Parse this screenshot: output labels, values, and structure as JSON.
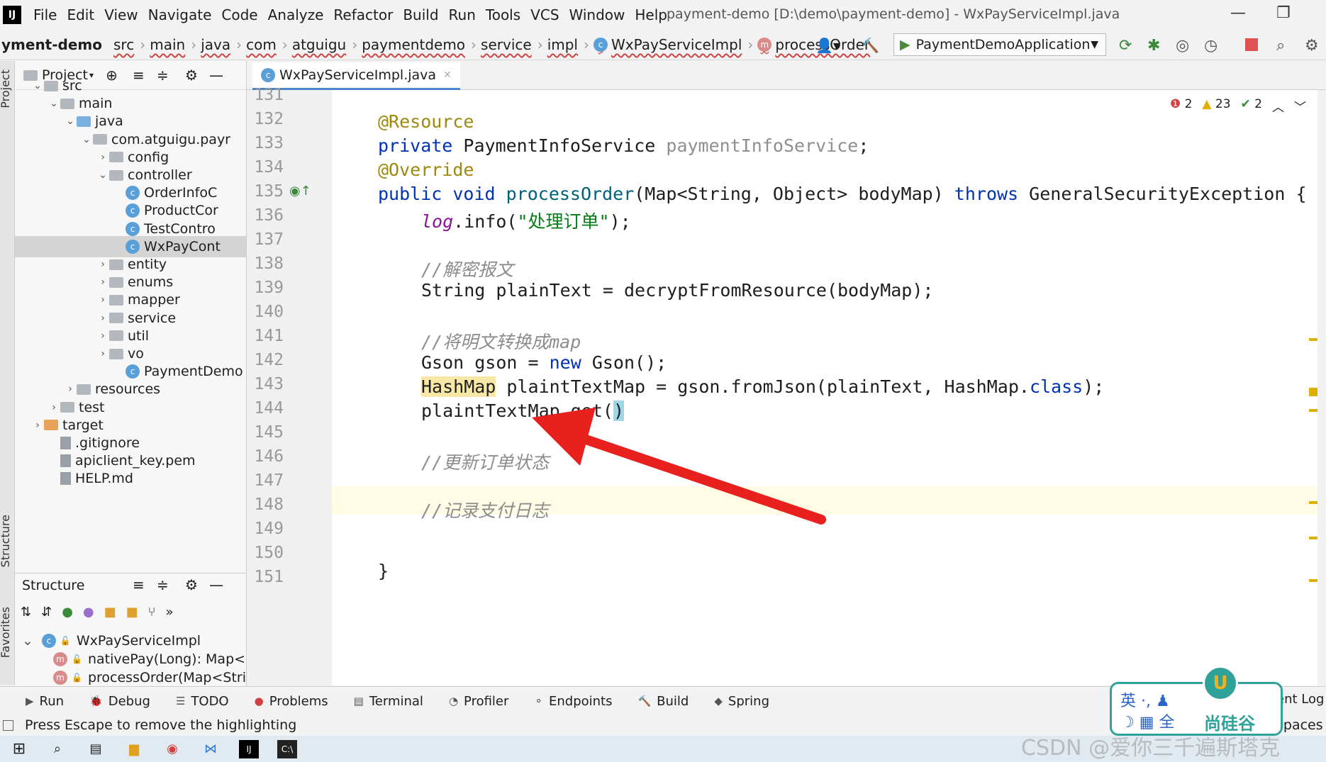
{
  "menu": {
    "logo": "IJ",
    "items": [
      "File",
      "Edit",
      "View",
      "Navigate",
      "Code",
      "Analyze",
      "Refactor",
      "Build",
      "Run",
      "Tools",
      "VCS",
      "Window",
      "Help"
    ],
    "window_title": "payment-demo [D:\\demo\\payment-demo] - WxPayServiceImpl.java"
  },
  "nav": {
    "project": "yment-demo",
    "crumbs": [
      "src",
      "main",
      "java",
      "com",
      "atguigu",
      "paymentdemo",
      "service",
      "impl",
      "WxPayServiceImpl",
      "processOrder"
    ],
    "run_config": "PaymentDemoApplication"
  },
  "left_strip": {
    "project": "Project",
    "structure": "Structure",
    "favorites": "Favorites"
  },
  "project": {
    "title": "Project",
    "tree": [
      {
        "label": "src",
        "indent": 1,
        "arrow": "v",
        "type": "folder"
      },
      {
        "label": "main",
        "indent": 2,
        "arrow": "v",
        "type": "folder"
      },
      {
        "label": "java",
        "indent": 3,
        "arrow": "v",
        "type": "folder-blue"
      },
      {
        "label": "com.atguigu.payr",
        "indent": 4,
        "arrow": "v",
        "type": "folder"
      },
      {
        "label": "config",
        "indent": 5,
        "arrow": ">",
        "type": "folder"
      },
      {
        "label": "controller",
        "indent": 5,
        "arrow": "v",
        "type": "folder"
      },
      {
        "label": "OrderInfoC",
        "indent": 6,
        "arrow": "",
        "type": "class"
      },
      {
        "label": "ProductCor",
        "indent": 6,
        "arrow": "",
        "type": "class"
      },
      {
        "label": "TestContro",
        "indent": 6,
        "arrow": "",
        "type": "class"
      },
      {
        "label": "WxPayCont",
        "indent": 6,
        "arrow": "",
        "type": "class",
        "selected": true
      },
      {
        "label": "entity",
        "indent": 5,
        "arrow": ">",
        "type": "folder"
      },
      {
        "label": "enums",
        "indent": 5,
        "arrow": ">",
        "type": "folder"
      },
      {
        "label": "mapper",
        "indent": 5,
        "arrow": ">",
        "type": "folder"
      },
      {
        "label": "service",
        "indent": 5,
        "arrow": ">",
        "type": "folder"
      },
      {
        "label": "util",
        "indent": 5,
        "arrow": ">",
        "type": "folder"
      },
      {
        "label": "vo",
        "indent": 5,
        "arrow": ">",
        "type": "folder"
      },
      {
        "label": "PaymentDemo",
        "indent": 6,
        "arrow": "",
        "type": "class"
      },
      {
        "label": "resources",
        "indent": 3,
        "arrow": ">",
        "type": "folder"
      },
      {
        "label": "test",
        "indent": 2,
        "arrow": ">",
        "type": "folder"
      },
      {
        "label": "target",
        "indent": 1,
        "arrow": ">",
        "type": "folder-orange"
      },
      {
        "label": ".gitignore",
        "indent": 2,
        "arrow": "",
        "type": "file"
      },
      {
        "label": "apiclient_key.pem",
        "indent": 2,
        "arrow": "",
        "type": "file"
      },
      {
        "label": "HELP.md",
        "indent": 2,
        "arrow": "",
        "type": "file"
      }
    ]
  },
  "structure": {
    "title": "Structure",
    "items": [
      {
        "label": "WxPayServiceImpl",
        "kind": "class"
      },
      {
        "label": "nativePay(Long): Map<S",
        "kind": "method"
      },
      {
        "label": "processOrder(Map<Stri",
        "kind": "method"
      }
    ]
  },
  "editor": {
    "tab": "WxPayServiceImpl.java",
    "inspections": {
      "errors": "2",
      "warnings": "23",
      "weak": "2"
    },
    "line_numbers": [
      "131",
      "132",
      "133",
      "134",
      "135",
      "136",
      "137",
      "138",
      "139",
      "140",
      "141",
      "142",
      "143",
      "144",
      "145",
      "146",
      "147",
      "148",
      "149",
      "150",
      "151"
    ],
    "lines": {
      "l132": "@Resource",
      "l133_kw": "private",
      "l133_type": " PaymentInfoService ",
      "l133_fld": "paymentInfoService",
      "l133_end": ";",
      "l134": "@Override",
      "l135_kw1": "public void",
      "l135_mth": " processOrder",
      "l135_params": "(Map<String, Object> bodyMap) ",
      "l135_throws": "throws",
      "l135_end": " GeneralSecurityException {",
      "l136_log": "log",
      "l136_mid": ".info(",
      "l136_str": "\"处理订单\"",
      "l136_end": ");",
      "l138": "//解密报文",
      "l139": "String plainText = decryptFromResource(bodyMap);",
      "l141": "//将明文转换成map",
      "l142_a": "Gson gson = ",
      "l142_kw": "new",
      "l142_b": " Gson();",
      "l143_a": "HashMap",
      "l143_b": " plaintTextMap = gson.fromJson(plainText, HashMap.",
      "l143_kw": "class",
      "l143_c": ");",
      "l144_a": "plaintTextMap.get(",
      "l144_b": ")",
      "l146": "//更新订单状态",
      "l148": "//记录支付日志",
      "l151": "}"
    }
  },
  "bottom_tools": [
    "Run",
    "Debug",
    "TODO",
    "Problems",
    "Terminal",
    "Profiler",
    "Endpoints",
    "Build",
    "Spring"
  ],
  "bottom_right": {
    "event_log": "ent Log",
    "spaces": "spaces"
  },
  "status": "Press Escape to remove the highlighting",
  "ime": {
    "line1": "英 ·, ♟",
    "line2": "☽ ▦ 全",
    "brand": "尚硅谷"
  },
  "watermark": "CSDN @爱你三千遍斯塔克"
}
